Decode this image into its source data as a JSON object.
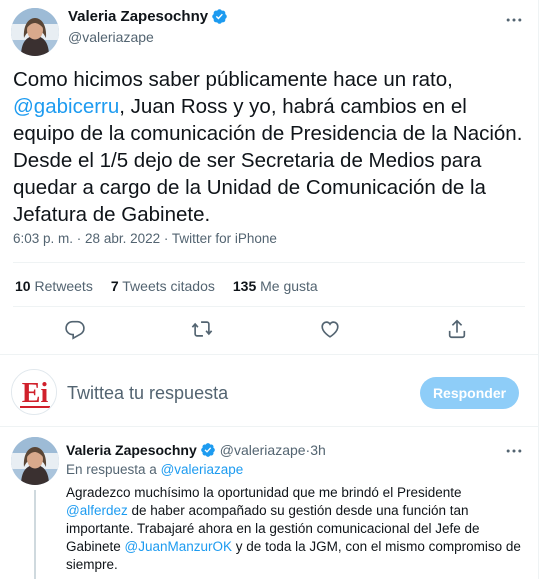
{
  "tweet": {
    "author_name": "Valeria Zapesochny",
    "author_handle": "@valeriazape",
    "text_1": "Como hicimos saber públicamente hace un rato, ",
    "mention": "@gabicerru",
    "text_2": ", Juan Ross y yo, habrá cambios en el equipo de la comunicación de Presidencia de la Nación. Desde el 1/5 dejo de ser Secretaria de Medios para quedar a cargo de la Unidad de Comunicación de la Jefatura de Gabinete.",
    "time": "6:03 p. m.",
    "date": "28 abr. 2022",
    "source": "Twitter for iPhone",
    "sep": " · "
  },
  "stats": {
    "retweets_count": "10",
    "retweets_label": " Retweets",
    "quotes_count": "7",
    "quotes_label": " Tweets citados",
    "likes_count": "135",
    "likes_label": " Me gusta"
  },
  "composer": {
    "placeholder": "Twittea tu respuesta",
    "reply_button": "Responder",
    "avatar_text": "Ei"
  },
  "reply": {
    "author_name": "Valeria Zapesochny",
    "author_handle": "@valeriazape",
    "sep": " · ",
    "time": "3h",
    "in_reply_prefix": "En respuesta a ",
    "in_reply_handle": "@valeriazape",
    "text_1": "Agradezco muchísimo la oportunidad que me brindó el Presidente ",
    "mention_1": "@alferdez",
    "text_2": " de haber acompañado su gestión desde una función tan importante. Trabajaré ahora en la gestión comunicacional del Jefe de Gabinete  ",
    "mention_2": "@JuanManzurOK",
    "text_3": " y de toda la JGM, con el mismo compromiso de siempre."
  },
  "colors": {
    "accent": "#1d9bf0",
    "reply_button_disabled": "#8ecdf8",
    "secondary_text": "#536471",
    "primary_text": "#0f1419",
    "logo_red": "#d0202b"
  },
  "icons": [
    "verified-badge-icon",
    "more-icon",
    "reply-icon",
    "retweet-icon",
    "like-icon",
    "share-icon"
  ]
}
